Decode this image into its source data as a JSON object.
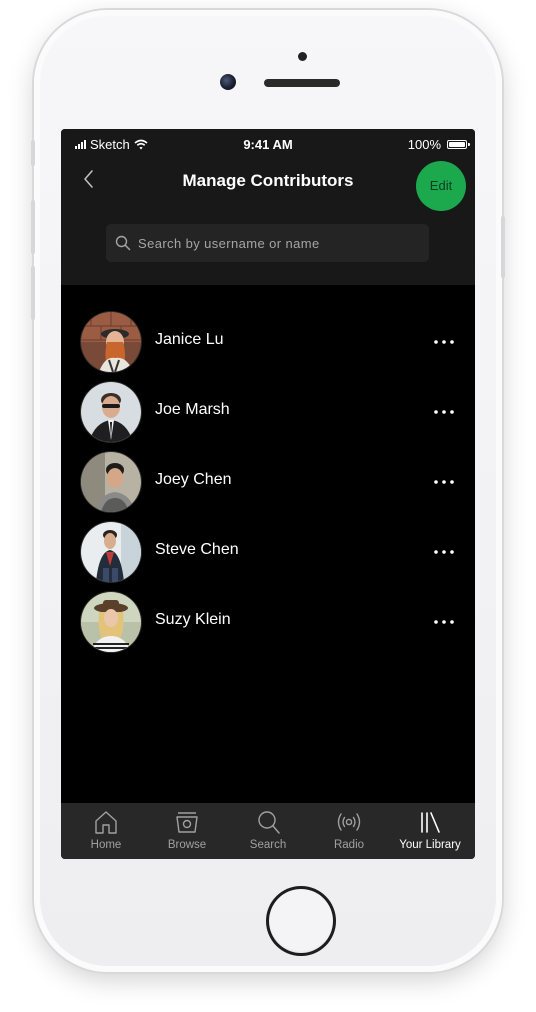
{
  "status_bar": {
    "carrier": "Sketch",
    "time": "9:41 AM",
    "battery": "100%"
  },
  "header": {
    "title": "Manage Contributors",
    "edit_label": "Edit"
  },
  "search": {
    "placeholder": "Search by username or name"
  },
  "contributors": [
    {
      "name": "Janice Lu"
    },
    {
      "name": "Joe Marsh"
    },
    {
      "name": "Joey Chen"
    },
    {
      "name": "Steve Chen"
    },
    {
      "name": "Suzy Klein"
    }
  ],
  "tabs": [
    {
      "label": "Home",
      "icon": "home-icon"
    },
    {
      "label": "Browse",
      "icon": "browse-icon"
    },
    {
      "label": "Search",
      "icon": "search-icon"
    },
    {
      "label": "Radio",
      "icon": "radio-icon"
    },
    {
      "label": "Your Library",
      "icon": "library-icon",
      "active": true
    }
  ],
  "colors": {
    "accent": "#1db954",
    "background": "#000000",
    "header_bg": "#181818",
    "tabbar_bg": "#282828"
  }
}
